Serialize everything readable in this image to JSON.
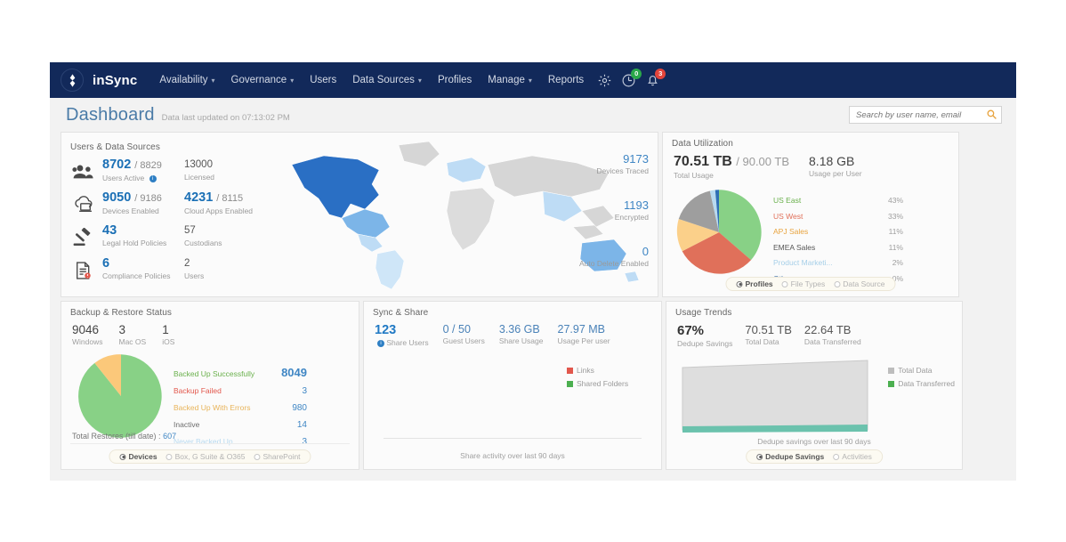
{
  "brand": {
    "name": "inSync",
    "logo_icon": "diamond-logo-icon",
    "navbar_color": "#12295a"
  },
  "nav": {
    "items": [
      {
        "label": "Availability",
        "has_caret": true
      },
      {
        "label": "Governance",
        "has_caret": true
      },
      {
        "label": "Users",
        "has_caret": false
      },
      {
        "label": "Data Sources",
        "has_caret": true
      },
      {
        "label": "Profiles",
        "has_caret": false
      },
      {
        "label": "Manage",
        "has_caret": true
      },
      {
        "label": "Reports",
        "has_caret": false
      }
    ],
    "icons": {
      "settings": "gear-icon",
      "activity": "clock-pie-icon",
      "activity_badge": "0",
      "alerts": "bell-icon",
      "alerts_badge": "3"
    }
  },
  "header": {
    "title": "Dashboard",
    "subtitle": "Data last updated on 07:13:02 PM",
    "search_placeholder": "Search by user name, email",
    "search_value": "",
    "search_icon": "magnifier-icon"
  },
  "users_card": {
    "title": "Users & Data Sources",
    "rows": [
      {
        "icon": "people-icon",
        "primary": {
          "value": "8702",
          "secondary": "/ 8829",
          "label": "Users Active",
          "info": true
        },
        "right": {
          "value": "13000",
          "label": "Licensed"
        }
      },
      {
        "icon": "cloud-device-icon",
        "primary": {
          "value": "9050",
          "secondary": "/ 9186",
          "label": "Devices Enabled",
          "info": false
        },
        "right": {
          "value": "4231",
          "secondary": "/ 8115",
          "label": "Cloud Apps Enabled",
          "highlight": true
        }
      },
      {
        "icon": "gavel-icon",
        "primary": {
          "value": "43",
          "secondary": "",
          "label": "Legal Hold Policies",
          "info": false
        },
        "right": {
          "value": "57",
          "label": "Custodians"
        }
      },
      {
        "icon": "compliance-doc-icon",
        "primary": {
          "value": "6",
          "secondary": "",
          "label": "Compliance Policies",
          "info": false
        },
        "right": {
          "value": "2",
          "label": "Users"
        }
      }
    ],
    "map_metrics": [
      {
        "value": "9173",
        "label": "Devices Traced"
      },
      {
        "value": "1193",
        "label": "Encrypted"
      },
      {
        "value": "0",
        "label": "Auto Delete Enabled"
      }
    ]
  },
  "utilization_card": {
    "title": "Data Utilization",
    "total_usage": {
      "value": "70.51 TB",
      "secondary": "/ 90.00 TB",
      "label": "Total Usage"
    },
    "per_user": {
      "value": "8.18 GB",
      "label": "Usage per User"
    },
    "radio": {
      "options": [
        "Profiles",
        "File Types",
        "Data Source"
      ],
      "selected": "Profiles"
    },
    "chart_data": {
      "type": "pie",
      "title": "Data Utilization by Profile",
      "labels": [
        "US East",
        "US West",
        "APJ Sales",
        "EMEA Sales",
        "Product Marketi...",
        "Others"
      ],
      "values": [
        43,
        33,
        11,
        11,
        2,
        0
      ],
      "display_percents": [
        "43%",
        "33%",
        "11%",
        "11%",
        "2%",
        "~0%"
      ],
      "colors": [
        "#88d186",
        "#e0705a",
        "#fbd08a",
        "#9e9e9e",
        "#b8daf0",
        "#2e6fb5"
      ],
      "label_colors": [
        "#6ab04c",
        "#e0705a",
        "#e8a33d",
        "#555555",
        "#a6cfe8",
        "#3a6fa8"
      ],
      "legend_position": "right"
    }
  },
  "backup_card": {
    "title": "Backup & Restore Status",
    "platforms": [
      {
        "value": "9046",
        "label": "Windows"
      },
      {
        "value": "3",
        "label": "Mac OS"
      },
      {
        "value": "1",
        "label": "iOS"
      }
    ],
    "total_restores_label": "Total Restores (till date) :",
    "total_restores_value": "607",
    "radio": {
      "options": [
        "Devices",
        "Box, G Suite & O365",
        "SharePoint"
      ],
      "selected": "Devices"
    },
    "chart_data": {
      "type": "pie",
      "title": "Backup Status",
      "labels": [
        "Backed Up Successfully",
        "Backup Failed",
        "Backed Up With Errors",
        "Inactive",
        "Never Backed Up"
      ],
      "values": [
        8049,
        3,
        980,
        14,
        3
      ],
      "colors": [
        "#88d186",
        "#e2574c",
        "#fbc87a",
        "#bdbdbd",
        "#b8daf0"
      ],
      "label_colors": [
        "#6ab04c",
        "#e2574c",
        "#e8b45a",
        "#6d6d6d",
        "#b8daf0"
      ],
      "legend_position": "right"
    }
  },
  "sync_card": {
    "title": "Sync & Share",
    "stats": [
      {
        "value": "123",
        "label": "Share Users",
        "info": true,
        "highlight": true
      },
      {
        "value": "0 / 50",
        "label": "Guest Users",
        "info": false
      },
      {
        "value": "3.36 GB",
        "label": "Share Usage",
        "info": false
      },
      {
        "value": "27.97 MB",
        "label": "Usage Per user",
        "info": false
      }
    ],
    "caption": "Share activity over last 90 days",
    "chart_data": {
      "type": "line",
      "title": "Share activity over last 90 days",
      "series": [
        {
          "name": "Links",
          "color": "#e2574c",
          "values": [
            0,
            0,
            0,
            0,
            0,
            0,
            0
          ]
        },
        {
          "name": "Shared Folders",
          "color": "#4caf50",
          "values": [
            0,
            0,
            0,
            0,
            0,
            0,
            0
          ]
        }
      ],
      "x": [
        "",
        "",
        "",
        "",
        "",
        "",
        ""
      ],
      "xlabel": "",
      "ylabel": "",
      "grid": false,
      "legend_position": "right"
    }
  },
  "usage_card": {
    "title": "Usage Trends",
    "stats": [
      {
        "value": "67%",
        "label": "Dedupe Savings",
        "bold": true
      },
      {
        "value": "70.51 TB",
        "label": "Total Data",
        "bold": false
      },
      {
        "value": "22.64 TB",
        "label": "Data Transferred",
        "bold": false
      }
    ],
    "caption": "Dedupe savings over last 90 days",
    "radio": {
      "options": [
        "Dedupe Savings",
        "Activities"
      ],
      "selected": "Dedupe Savings"
    },
    "chart_data": {
      "type": "area",
      "title": "Dedupe savings over last 90 days",
      "series": [
        {
          "name": "Total Data",
          "color": "#d9d9d9",
          "values": [
            66,
            67,
            68,
            69,
            70,
            70.2,
            70.51
          ]
        },
        {
          "name": "Data Transferred",
          "color": "#5cbfa8",
          "values": [
            1.6,
            1.8,
            2.0,
            2.1,
            2.3,
            2.4,
            2.5
          ]
        }
      ],
      "x": [
        "",
        "",
        "",
        "",
        "",
        "",
        ""
      ],
      "ylabel": "",
      "xlabel": "",
      "grid": false,
      "legend_position": "right"
    }
  }
}
